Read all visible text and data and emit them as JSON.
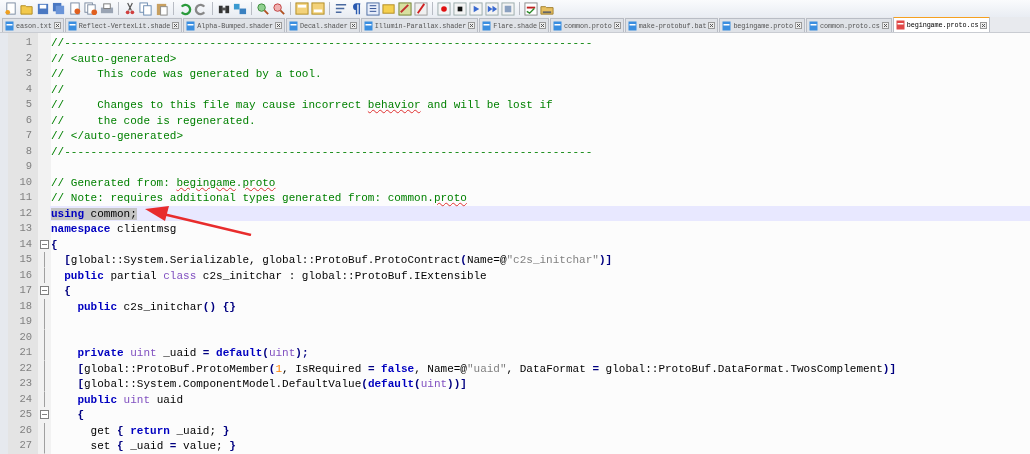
{
  "tabs": [
    {
      "label": "eason.txt",
      "selected": false
    },
    {
      "label": "Reflect-VertexLit.shade",
      "selected": false
    },
    {
      "label": "Alpha-Bumped.shader",
      "selected": false
    },
    {
      "label": "Decal.shader",
      "selected": false
    },
    {
      "label": "Illumin-Parallax.shader",
      "selected": false
    },
    {
      "label": "Flare.shade",
      "selected": false
    },
    {
      "label": "common.proto",
      "selected": false
    },
    {
      "label": "make-protobuf.bat",
      "selected": false
    },
    {
      "label": "begingame.proto",
      "selected": false
    },
    {
      "label": "common.proto.cs",
      "selected": false
    },
    {
      "label": "begingame.proto.cs",
      "selected": true
    }
  ],
  "editor": {
    "lines": [
      {
        "number": "1",
        "current": false,
        "fold_start": false,
        "in_fold": false,
        "segments": [
          {
            "kind": "comment",
            "text": "//--------------------------------------------------------------------------------"
          }
        ]
      },
      {
        "number": "2",
        "current": false,
        "fold_start": false,
        "in_fold": false,
        "segments": [
          {
            "kind": "comment",
            "text": "// <auto-generated>"
          }
        ]
      },
      {
        "number": "3",
        "current": false,
        "fold_start": false,
        "in_fold": false,
        "segments": [
          {
            "kind": "comment",
            "text": "//     This code was generated by a tool."
          }
        ]
      },
      {
        "number": "4",
        "current": false,
        "fold_start": false,
        "in_fold": false,
        "segments": [
          {
            "kind": "comment",
            "text": "//"
          }
        ]
      },
      {
        "number": "5",
        "current": false,
        "fold_start": false,
        "in_fold": false,
        "segments": [
          {
            "kind": "comment",
            "text": "//     Changes to this file may cause incorrect "
          },
          {
            "kind": "misspelled",
            "text": "behavior"
          },
          {
            "kind": "comment",
            "text": " and will be lost if"
          }
        ]
      },
      {
        "number": "6",
        "current": false,
        "fold_start": false,
        "in_fold": false,
        "segments": [
          {
            "kind": "comment",
            "text": "//     the code is regenerated."
          }
        ]
      },
      {
        "number": "7",
        "current": false,
        "fold_start": false,
        "in_fold": false,
        "segments": [
          {
            "kind": "comment",
            "text": "// </auto-generated>"
          }
        ]
      },
      {
        "number": "8",
        "current": false,
        "fold_start": false,
        "in_fold": false,
        "segments": [
          {
            "kind": "comment",
            "text": "//--------------------------------------------------------------------------------"
          }
        ]
      },
      {
        "number": "9",
        "current": false,
        "fold_start": false,
        "in_fold": false
      },
      {
        "number": "10",
        "current": false,
        "fold_start": false,
        "in_fold": false,
        "segments": [
          {
            "kind": "comment",
            "text": "// Generated from: "
          },
          {
            "kind": "misspelled",
            "text": "begingame"
          },
          {
            "kind": "comment",
            "text": "."
          },
          {
            "kind": "misspelled",
            "text": "proto"
          }
        ]
      },
      {
        "number": "11",
        "current": false,
        "fold_start": false,
        "in_fold": false,
        "segments": [
          {
            "kind": "comment",
            "text": "// Note: requires additional types generated from: common."
          },
          {
            "kind": "misspelled",
            "text": "proto"
          }
        ]
      },
      {
        "number": "12",
        "current": true,
        "fold_start": false,
        "in_fold": false,
        "segments": [
          {
            "kind": "keyword",
            "text": "using",
            "selected": true
          },
          {
            "kind": "plain",
            "text": " common;",
            "selected": true
          }
        ]
      },
      {
        "number": "13",
        "current": false,
        "fold_start": false,
        "in_fold": false,
        "segments": [
          {
            "kind": "keyword",
            "text": "namespace"
          },
          {
            "kind": "plain",
            "text": " clientmsg"
          }
        ]
      },
      {
        "number": "14",
        "current": false,
        "fold_start": true,
        "in_fold": false,
        "segments": [
          {
            "kind": "operator",
            "text": "{"
          }
        ]
      },
      {
        "number": "15",
        "current": false,
        "fold_start": false,
        "in_fold": true,
        "segments": [
          {
            "kind": "operator",
            "text": "  ["
          },
          {
            "kind": "plain",
            "text": "global::System.Serializable, global::ProtoBuf.ProtoContract"
          },
          {
            "kind": "operator",
            "text": "("
          },
          {
            "kind": "plain",
            "text": "Name=@"
          },
          {
            "kind": "string",
            "text": "\"c2s_initchar\""
          },
          {
            "kind": "operator",
            "text": ")]"
          }
        ]
      },
      {
        "number": "16",
        "current": false,
        "fold_start": false,
        "in_fold": true,
        "segments": [
          {
            "kind": "keyword",
            "text": "  public"
          },
          {
            "kind": "plain",
            "text": " partial "
          },
          {
            "kind": "type",
            "text": "class"
          },
          {
            "kind": "plain",
            "text": " c2s_initchar : global::ProtoBuf.IExtensible"
          }
        ]
      },
      {
        "number": "17",
        "current": false,
        "fold_start": true,
        "in_fold": true,
        "segments": [
          {
            "kind": "operator",
            "text": "  {"
          }
        ]
      },
      {
        "number": "18",
        "current": false,
        "fold_start": false,
        "in_fold": true,
        "segments": [
          {
            "kind": "keyword",
            "text": "    public"
          },
          {
            "kind": "plain",
            "text": " c2s_initchar"
          },
          {
            "kind": "operator",
            "text": "() {}"
          }
        ]
      },
      {
        "number": "19",
        "current": false,
        "fold_start": false,
        "in_fold": true
      },
      {
        "number": "20",
        "current": false,
        "fold_start": false,
        "in_fold": true
      },
      {
        "number": "21",
        "current": false,
        "fold_start": false,
        "in_fold": true,
        "segments": [
          {
            "kind": "keyword",
            "text": "    private"
          },
          {
            "kind": "type",
            "text": " uint"
          },
          {
            "kind": "plain",
            "text": " _uaid "
          },
          {
            "kind": "operator",
            "text": "="
          },
          {
            "kind": "keyword",
            "text": " default"
          },
          {
            "kind": "operator",
            "text": "("
          },
          {
            "kind": "type",
            "text": "uint"
          },
          {
            "kind": "operator",
            "text": ");"
          }
        ]
      },
      {
        "number": "22",
        "current": false,
        "fold_start": false,
        "in_fold": true,
        "segments": [
          {
            "kind": "operator",
            "text": "    ["
          },
          {
            "kind": "plain",
            "text": "global::ProtoBuf.ProtoMember"
          },
          {
            "kind": "operator",
            "text": "("
          },
          {
            "kind": "number",
            "text": "1"
          },
          {
            "kind": "plain",
            "text": ", IsRequired "
          },
          {
            "kind": "operator",
            "text": "="
          },
          {
            "kind": "keyword",
            "text": " false"
          },
          {
            "kind": "plain",
            "text": ", Name=@"
          },
          {
            "kind": "string",
            "text": "\"uaid\""
          },
          {
            "kind": "plain",
            "text": ", DataFormat "
          },
          {
            "kind": "operator",
            "text": "="
          },
          {
            "kind": "plain",
            "text": " global::ProtoBuf.DataFormat.TwosComplement"
          },
          {
            "kind": "operator",
            "text": ")]"
          }
        ]
      },
      {
        "number": "23",
        "current": false,
        "fold_start": false,
        "in_fold": true,
        "segments": [
          {
            "kind": "operator",
            "text": "    ["
          },
          {
            "kind": "plain",
            "text": "global::System.ComponentModel.DefaultValue"
          },
          {
            "kind": "operator",
            "text": "("
          },
          {
            "kind": "keyword",
            "text": "default"
          },
          {
            "kind": "operator",
            "text": "("
          },
          {
            "kind": "type",
            "text": "uint"
          },
          {
            "kind": "operator",
            "text": "))]"
          }
        ]
      },
      {
        "number": "24",
        "current": false,
        "fold_start": false,
        "in_fold": true,
        "segments": [
          {
            "kind": "keyword",
            "text": "    public"
          },
          {
            "kind": "type",
            "text": " uint"
          },
          {
            "kind": "plain",
            "text": " uaid"
          }
        ]
      },
      {
        "number": "25",
        "current": false,
        "fold_start": true,
        "in_fold": true,
        "segments": [
          {
            "kind": "operator",
            "text": "    {"
          }
        ]
      },
      {
        "number": "26",
        "current": false,
        "fold_start": false,
        "in_fold": true,
        "segments": [
          {
            "kind": "plain",
            "text": "      get "
          },
          {
            "kind": "operator",
            "text": "{"
          },
          {
            "kind": "keyword",
            "text": " return"
          },
          {
            "kind": "plain",
            "text": " _uaid; "
          },
          {
            "kind": "operator",
            "text": "}"
          }
        ]
      },
      {
        "number": "27",
        "current": false,
        "fold_start": false,
        "in_fold": true,
        "segments": [
          {
            "kind": "plain",
            "text": "      set "
          },
          {
            "kind": "operator",
            "text": "{"
          },
          {
            "kind": "plain",
            "text": " _uaid "
          },
          {
            "kind": "operator",
            "text": "="
          },
          {
            "kind": "plain",
            "text": " value; "
          },
          {
            "kind": "operator",
            "text": "}"
          }
        ]
      }
    ]
  }
}
